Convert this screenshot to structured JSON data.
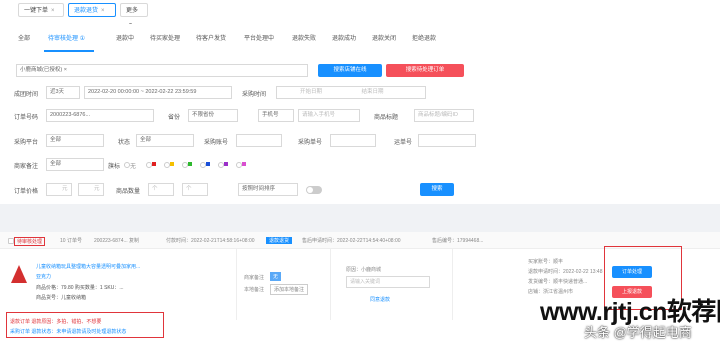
{
  "topbar": {
    "tabs": [
      {
        "label": "一键下单"
      },
      {
        "label": "退款退货"
      },
      {
        "label": "更多"
      }
    ]
  },
  "tabs": [
    "全部",
    "待审核处理 ①",
    "退款中",
    "待买家处理",
    "待客户发货",
    "平台处理中",
    "退款失败",
    "退款成功",
    "退款关闭",
    "拒绝退款"
  ],
  "filters": {
    "shop_tag": "小鹿商城(已授权)",
    "btn_search_shop": "搜索店铺在线",
    "btn_pending": "搜索待处理订单",
    "label_time": "成团时间",
    "time_range_value": "近3天",
    "date_range": "2022-02-20 00:00:00 ~ 2022-02-22 23:59:59",
    "label_purchase_time": "采购时间",
    "purchase_start": "开始日期",
    "purchase_end": "结束日期",
    "label_order_no": "订单号码",
    "order_no_value": "2000223-6876...",
    "label_province": "省份",
    "province_value": "不限省份",
    "phone_select": "手机号",
    "phone_placeholder": "请输入手机号",
    "label_title": "商品标题",
    "title_placeholder": "商品标题/编码ID",
    "label_platform": "采购平台",
    "platform_value": "全部",
    "label_status": "状态",
    "status_value": "全部",
    "label_purchase_no": "采购账号",
    "label_purchase_order": "采购单号",
    "label_tracking": "运单号",
    "label_merchant_note": "商家备注",
    "merchant_note_value": "全部",
    "label_flag": "旗标",
    "flag_none": "无",
    "label_price": "订单价格",
    "price_from": "元",
    "price_to": "元",
    "label_qty": "商品数量",
    "qty_from": "个",
    "qty_to": "个",
    "sort_value": "按照时间排序",
    "btn_search": "搜索"
  },
  "order": {
    "select_label": "待审核处理",
    "no_label": "10  订单号",
    "order_no": "200223-6874... 复制",
    "pay_time": "付款时间：2022-02-21T14:58:16+08:00",
    "badge": "退款退货",
    "apply_time": "售后申请时间：2022-02-22T14:54:40+08:00",
    "after_sale_no": "售后编号：17994468...",
    "product_title": "儿童收纳箱玩具整理箱大容量透明可叠加家用...",
    "sku": "亚克力",
    "price_line": "商品价格：79.80  购买数量：1  SKU：...",
    "buyer": "商品货号：儿童收纳箱",
    "merchant_note_label": "商家备注",
    "merchant_note_btn": "无",
    "note_label": "本地备注",
    "note_btn": "添加本地备注",
    "reason": "原因：小鹿商城",
    "reason_placeholder": "请输入关键词",
    "refund_link": "同意退款",
    "buyer_name": "买家账号：顺丰",
    "apply_time2": "退款申请时间：2022-02-22 13:48",
    "ship_info": "发货编号：顺丰快递普通...",
    "shop_info": "店铺：浙江省温州市",
    "btn_approve": "订单处理",
    "btn_reject": "上报退款",
    "info1": "退款订单 退款原因：多拍、错拍、不想要",
    "info2": "采购订单 退款状态：未申请退款请及时处理退款状态"
  },
  "watermark": {
    "line1": "www.rjtj.cn软荐网",
    "line2": "头条 @学得起电商"
  },
  "colors": {
    "accent": "#1890ff",
    "danger": "#e0353b"
  }
}
